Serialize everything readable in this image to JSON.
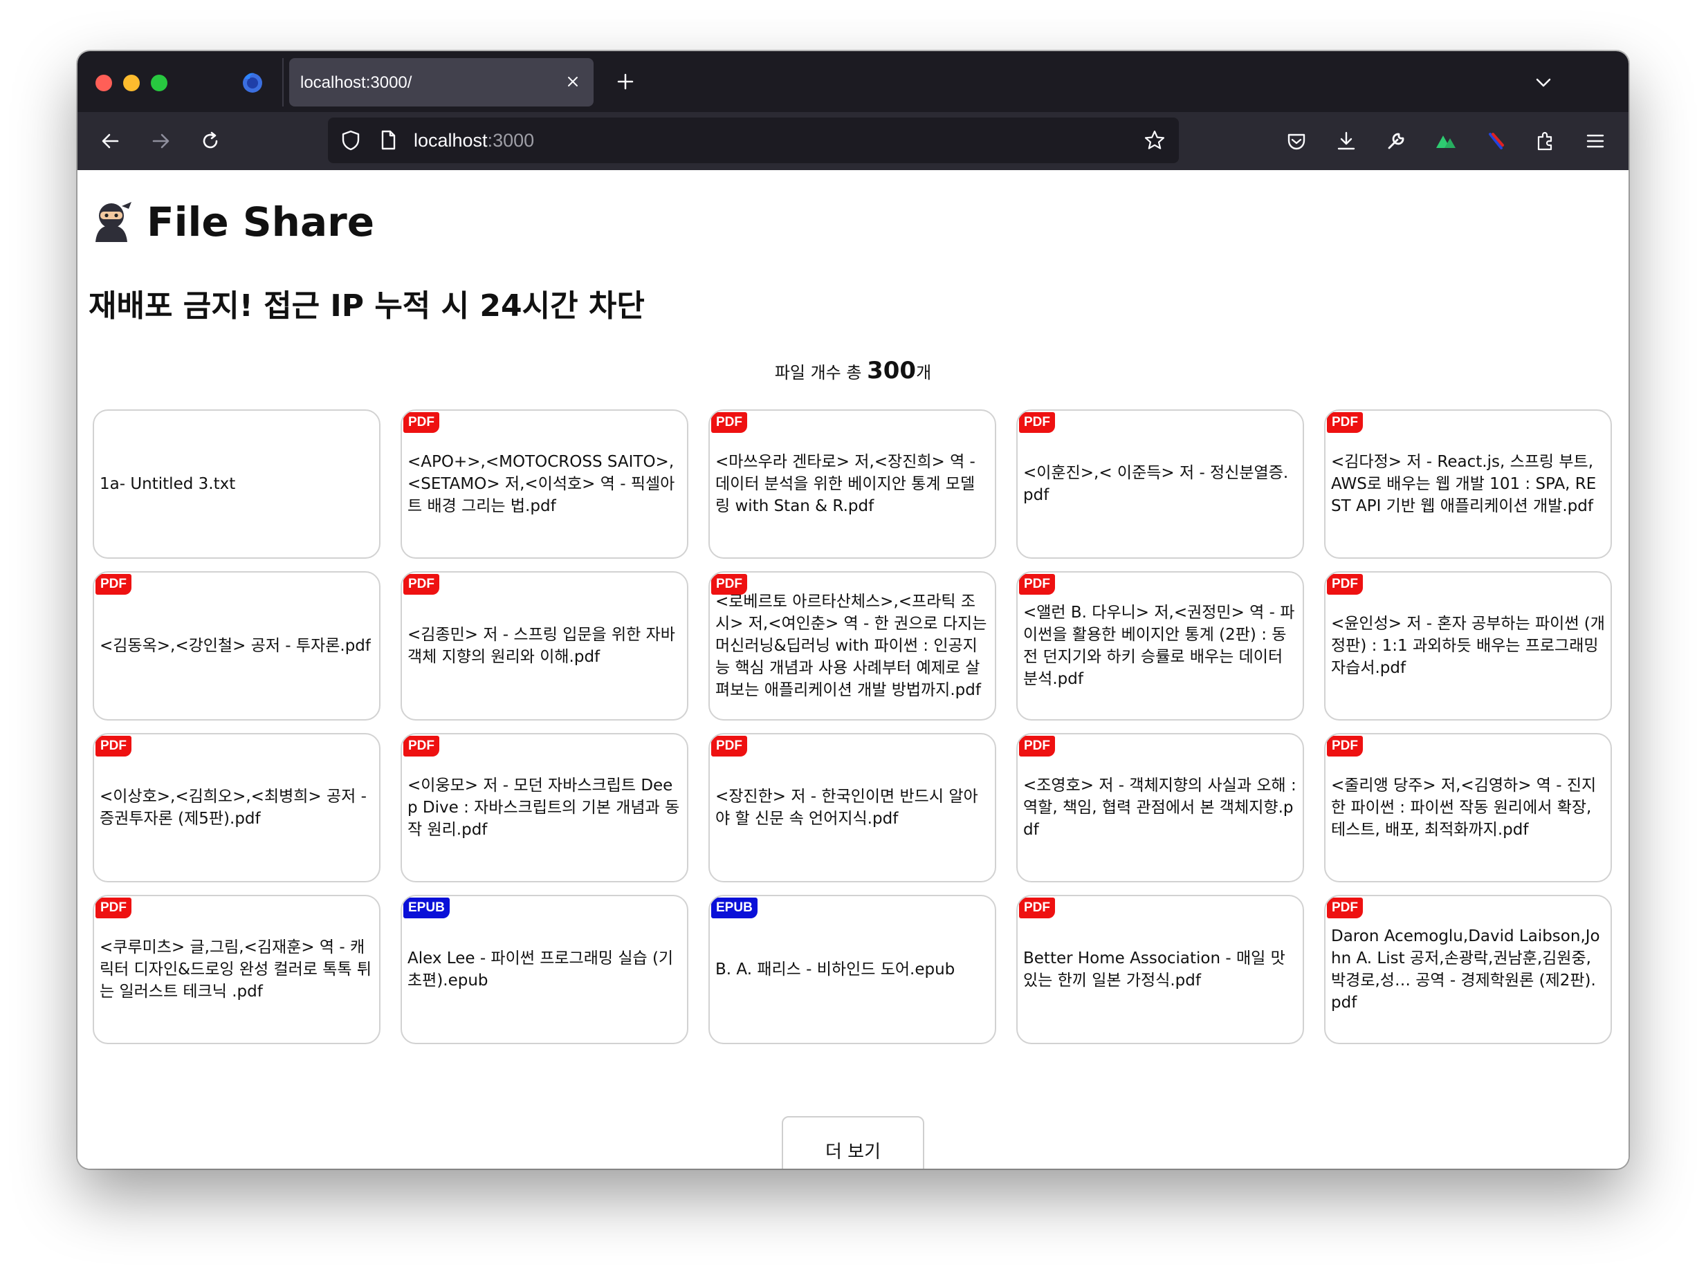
{
  "browser": {
    "tab_title": "localhost:3000/",
    "url_host": "localhost",
    "url_port": ":3000"
  },
  "header": {
    "icon": "ninja-icon",
    "title": "File Share",
    "notice": "재배포 금지! 접근 IP 누적 시 24시간 차단"
  },
  "file_count": {
    "prefix": "파일 개수 총 ",
    "value": "300",
    "suffix": "개"
  },
  "badge_colors": {
    "PDF": "#ee1111",
    "EPUB": "#0a10d8"
  },
  "files": [
    {
      "name": "1a- Untitled 3.txt",
      "badge": ""
    },
    {
      "name": "<APO+>,<MOTOCROSS SAITO>,<SETAMO> 저,<이석호> 역 - 픽셀아트 배경 그리는 법.pdf",
      "badge": "PDF"
    },
    {
      "name": "<마쓰우라 겐타로> 저,<장진희> 역 - 데이터 분석을 위한 베이지안 통계 모델링 with Stan & R.pdf",
      "badge": "PDF"
    },
    {
      "name": "<이훈진>,< 이준득> 저 - 정신분열증.pdf",
      "badge": "PDF"
    },
    {
      "name": "<김다정> 저 - React.js, 스프링 부트, AWS로 배우는 웹 개발 101 : SPA, REST API 기반 웹 애플리케이션 개발.pdf",
      "badge": "PDF"
    },
    {
      "name": "<김동옥>,<강인철> 공저 - 투자론.pdf",
      "badge": "PDF"
    },
    {
      "name": "<김종민> 저 - 스프링 입문을 위한 자바 객체 지향의 원리와 이해.pdf",
      "badge": "PDF"
    },
    {
      "name": "<로베르토 아르타산체스>,<프라틱 조시> 저,<여인춘> 역 - 한 권으로 다지는 머신러닝&딥러닝 with 파이썬 : 인공지능 핵심 개념과 사용 사례부터 예제로 살펴보는 애플리케이션 개발 방법까지.pdf",
      "badge": "PDF"
    },
    {
      "name": "<앨런 B. 다우니> 저,<권정민> 역 - 파이썬을 활용한 베이지안 통계 (2판) : 동전 던지기와 하키 승률로 배우는 데이터 분석.pdf",
      "badge": "PDF"
    },
    {
      "name": "<윤인성> 저 - 혼자 공부하는 파이썬 (개정판) : 1:1 과외하듯 배우는 프로그래밍 자습서.pdf",
      "badge": "PDF"
    },
    {
      "name": "<이상호>,<김희오>,<최병희> 공저 - 증권투자론 (제5판).pdf",
      "badge": "PDF"
    },
    {
      "name": "<이웅모> 저 - 모던 자바스크립트 Deep Dive : 자바스크립트의 기본 개념과 동작 원리.pdf",
      "badge": "PDF"
    },
    {
      "name": "<장진한> 저 - 한국인이면 반드시 알아야 할 신문 속 언어지식.pdf",
      "badge": "PDF"
    },
    {
      "name": "<조영호> 저 - 객체지향의 사실과 오해 : 역할, 책임, 협력 관점에서 본 객체지향.pdf",
      "badge": "PDF"
    },
    {
      "name": "<줄리앵 당주> 저,<김영하> 역 - 진지한 파이썬 : 파이썬 작동 원리에서 확장, 테스트, 배포, 최적화까지.pdf",
      "badge": "PDF"
    },
    {
      "name": "<쿠루미츠> 글,그림,<김재훈> 역  - 캐릭터 디자인&드로잉 완성 컬러로 톡톡 튀는 일러스트 테크닉 .pdf",
      "badge": "PDF"
    },
    {
      "name": "Alex Lee - 파이썬 프로그래밍 실습 (기초편).epub",
      "badge": "EPUB"
    },
    {
      "name": "B. A. 패리스 - 비하인드 도어.epub",
      "badge": "EPUB"
    },
    {
      "name": "Better Home Association - 매일 맛있는 한끼 일본 가정식.pdf",
      "badge": "PDF"
    },
    {
      "name": "Daron Acemoglu,David Laibson,John A. List 공저,손광락,권남훈,김원중,박경로,성… 공역 - 경제학원론 (제2판).pdf",
      "badge": "PDF"
    }
  ],
  "more_button": "더 보기"
}
